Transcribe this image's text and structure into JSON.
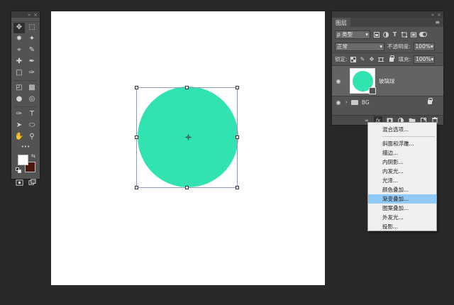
{
  "tools": {
    "rows": [
      [
        "move-icon",
        "marquee-icon"
      ],
      [
        "lasso-icon",
        "magic-wand-icon"
      ],
      [
        "crop-icon",
        "eyedropper-icon"
      ],
      [
        "healing-brush-icon",
        "brush-icon"
      ],
      [
        "clone-stamp-icon",
        "history-brush-icon"
      ],
      [
        "eraser-icon",
        "gradient-icon"
      ],
      [
        "blur-icon",
        "dodge-icon"
      ],
      [
        "pen-icon",
        "type-icon"
      ],
      [
        "path-selection-icon",
        "ellipse-tool-icon"
      ],
      [
        "hand-icon",
        "zoom-icon"
      ]
    ],
    "more": "•••",
    "foreground_color": "#ffffff",
    "background_color": "#4a1a10"
  },
  "canvas": {
    "background": "#ffffff",
    "shape_color": "#30e3b0"
  },
  "layers_panel": {
    "tab": "图层",
    "filter_label": "ρ 类型",
    "blend_mode": "正常",
    "opacity_label": "不透明度:",
    "opacity_value": "100%",
    "lock_label": "锁定:",
    "fill_label": "填充:",
    "fill_value": "100%",
    "layers": [
      {
        "name": "玻璃球"
      },
      {
        "name": "BG"
      }
    ],
    "footer_fx": "fx"
  },
  "context_menu": {
    "items": [
      "混合选项...",
      "斜面和浮雕...",
      "描边...",
      "内阴影...",
      "内发光...",
      "光泽...",
      "颜色叠加...",
      "渐变叠加...",
      "图案叠加...",
      "外发光...",
      "投影..."
    ],
    "highlighted": "渐变叠加..."
  }
}
